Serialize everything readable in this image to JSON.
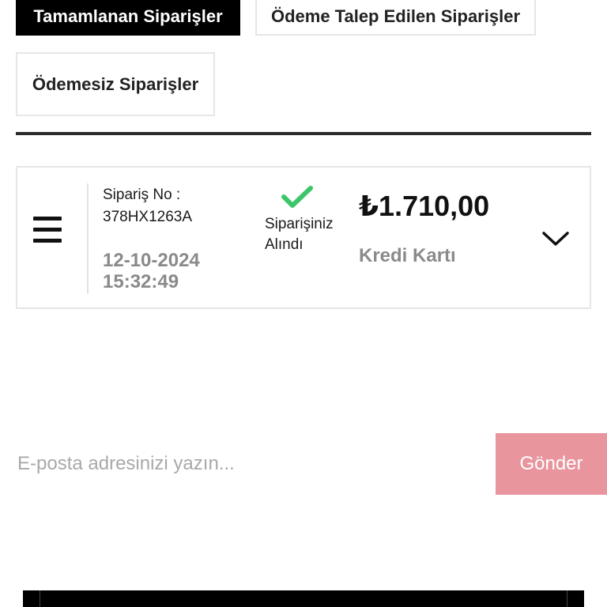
{
  "tabs": {
    "completed": "Tamamlanan Siparişler",
    "payment_requested": "Ödeme Talep Edilen Siparişler",
    "unpaid": "Ödemesiz Siparişler"
  },
  "order": {
    "number_label": "Sipariş No :",
    "number": "378HX1263A",
    "date": "12-10-2024",
    "time": "15:32:49",
    "status_line1": "Siparişiniz",
    "status_line2": "Alındı",
    "amount": "₺1.710,00",
    "payment_method": "Kredi Kartı",
    "icons": {
      "menu": "menu-icon",
      "status": "check-icon",
      "expand": "chevron-down-icon"
    }
  },
  "newsletter": {
    "placeholder": "E-posta adresinizi yazın...",
    "submit_label": "Gönder"
  },
  "colors": {
    "active_tab_bg": "#000000",
    "check_green": "#3cc569",
    "submit_bg": "#e8959e",
    "muted_text": "#8a8a8a"
  }
}
